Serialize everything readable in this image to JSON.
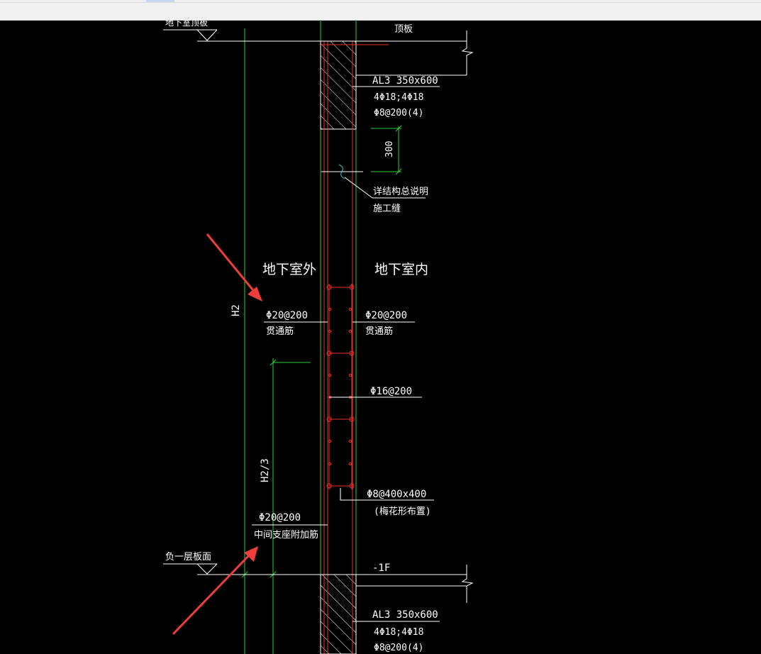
{
  "window": {
    "background": "#000000",
    "toolbar_color": "#f0f0f0"
  },
  "colors": {
    "line": "#ffffff",
    "wall": "#e8342b",
    "dim": "#29d13c",
    "cyan": "#35c9d8",
    "annotation": "#ef3d3d"
  },
  "labels": {
    "top_slab_level": "地下室顶板",
    "top_slab": "顶板",
    "beam_top": {
      "name": "AL3 350x600",
      "main_bars": "4Φ18;4Φ18",
      "stirrups": "Φ8@200(4)"
    },
    "dim_300": "300",
    "joint_note_1": "详结构总说明",
    "joint_note_2": "施工缝",
    "outside": "地下室外",
    "inside": "地下室内",
    "dim_h2": "H2",
    "rebar_outer_spec": "Φ20@200",
    "rebar_outer_note": "贯通筋",
    "rebar_inner_spec": "Φ20@200",
    "rebar_inner_note": "贯通筋",
    "horizontal_bars": "Φ16@200",
    "dim_h2_3": "H2/3",
    "tie_bars": "Φ8@400x400",
    "tie_note": "(梅花形布置)",
    "support_spec": "Φ20@200",
    "support_note": "中间支座附加筋",
    "floor_level": "负一层板面",
    "floor_tag": "-1F",
    "beam_bottom": {
      "name": "AL3 350x600",
      "main_bars": "4Φ18;4Φ18",
      "stirrups": "Φ8@200(4)"
    }
  }
}
